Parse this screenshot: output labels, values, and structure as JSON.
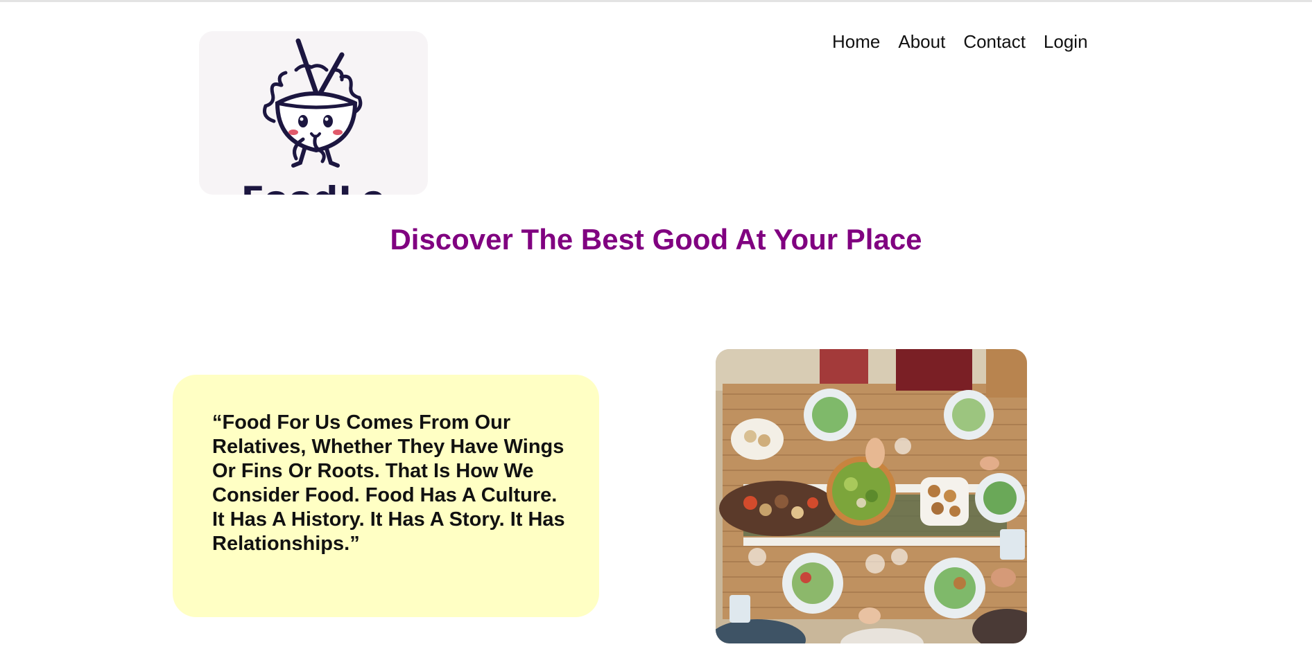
{
  "brand": {
    "name": "FoodLe",
    "logo_icon": "noodle-bowl-mascot-icon"
  },
  "nav": {
    "items": [
      {
        "label": "Home"
      },
      {
        "label": "About"
      },
      {
        "label": "Contact"
      },
      {
        "label": "Login"
      }
    ]
  },
  "hero": {
    "headline": "Discover The Best Good At Your Place"
  },
  "quote": {
    "text": "“Food For Us Comes From Our Relatives, Whether They Have Wings Or Fins Or Roots. That Is How We Consider Food. Food Has A Culture. It Has A History. It Has A Story. It Has Relationships.”"
  },
  "image": {
    "subject": "shared-dinner-table-photo"
  },
  "colors": {
    "headline": "#800080",
    "quote_background": "#ffffc4",
    "logo_ink": "#1c1640",
    "logo_background": "#f7f4f6"
  }
}
